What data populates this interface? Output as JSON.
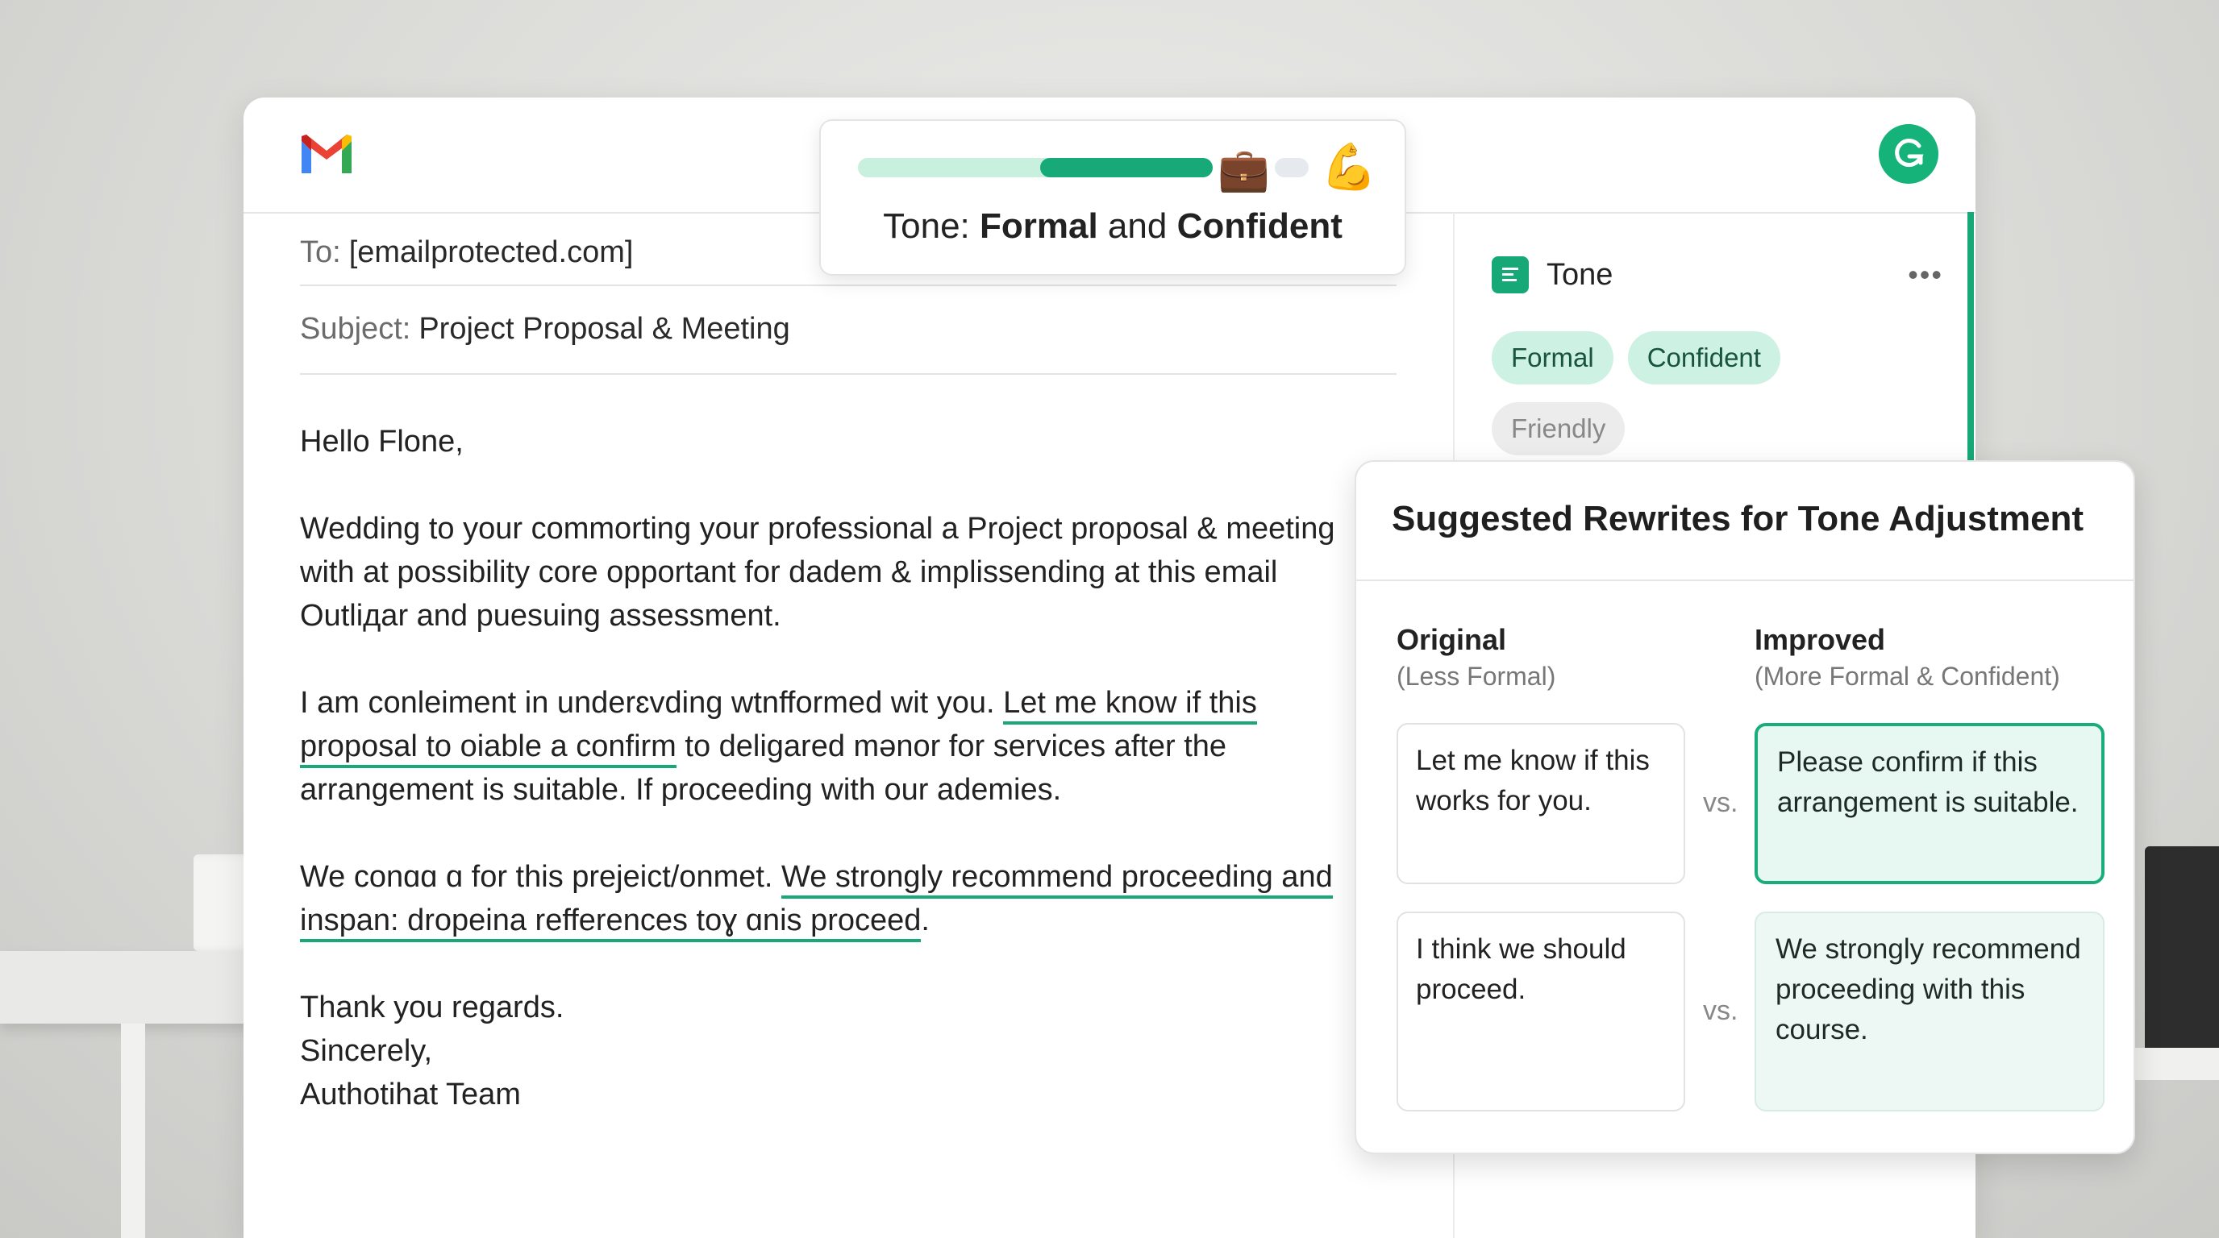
{
  "email": {
    "to_label": "To:",
    "to_value": "[emailprotected.com]",
    "subject_label": "Subject:",
    "subject_value": "Project Proposal & Meeting",
    "greeting": "Hello Flone,",
    "p1": "Wedding to your commorting your professional a Project proposal & meeting with at possibility core opportant for dadem & implissending at this email Outliдar and puesuing assessment.",
    "p2_a": "I am conleiment in underɛvding wtnfformed wit you. ",
    "p2_hl": "Let me know if this proposal to oiable a confirm",
    "p2_b": " to deligared mǝnor for services after the arrangement is suitable. If proceeding with our ademies.",
    "p3_a": "We conɑɑ ɑ for this prejeict/onmet. ",
    "p3_hl": "We strongly recommend proceeding and inspan: dropeina refferences toɣ ɑnis proceed",
    "p3_b": ".",
    "closing1": "Thank you regards.",
    "closing2": "Sincerely,",
    "closing3": "Authotihat Team"
  },
  "tone_popup": {
    "prefix": "Tone: ",
    "tone1": "Formal",
    "connector": " and ",
    "tone2": "Confident",
    "level": 0.92,
    "emoji_left": "💼",
    "emoji_right": "💪"
  },
  "tone_panel": {
    "title": "Tone",
    "menu": "•••",
    "chips": [
      "Formal",
      "Confident",
      "Friendly"
    ]
  },
  "suggestions": {
    "title": "Suggested Rewrites for Tone Adjustment",
    "original_head": "Original",
    "original_sub": "(Less Formal)",
    "improved_head": "Improved",
    "improved_sub": "(More Formal & Confident)",
    "vs": "vs.",
    "rows": [
      {
        "original": "Let me know if this works for you.",
        "improved": "Please confirm if this arrangement is suitable."
      },
      {
        "original": "I think we should proceed.",
        "improved": "We strongly recommend proceeding with this course."
      }
    ]
  },
  "icons": {
    "gmail": "gmail-logo-icon",
    "grammarly": "grammarly-g-icon",
    "tone": "document-lines-icon"
  },
  "colors": {
    "accent": "#16a877",
    "chip_active_bg": "#cdf1e2",
    "selected_bg": "#e7f7f1"
  }
}
